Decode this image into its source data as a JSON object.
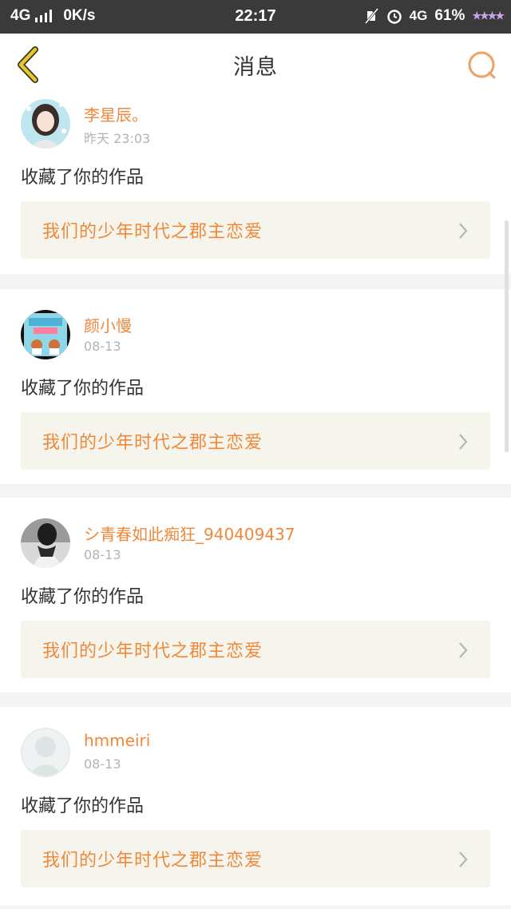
{
  "status_bar": {
    "network": "4G",
    "speed": "0K/s",
    "time": "22:17",
    "network_right": "4G",
    "battery": "61%"
  },
  "nav": {
    "title": "消息"
  },
  "messages": [
    {
      "user": "李星辰。",
      "time": "昨天 23:03",
      "action": "收藏了你的作品",
      "work_title": "我们的少年时代之郡主恋爱"
    },
    {
      "user": "颜小慢",
      "time": "08-13",
      "action": "收藏了你的作品",
      "work_title": "我们的少年时代之郡主恋爱"
    },
    {
      "user": "シ青春如此痴狂_940409437",
      "time": "08-13",
      "action": "收藏了你的作品",
      "work_title": "我们的少年时代之郡主恋爱"
    },
    {
      "user": "hmmeiri",
      "time": "08-13",
      "action": "收藏了你的作品",
      "work_title": "我们的少年时代之郡主恋爱"
    }
  ],
  "colors": {
    "accent": "#f0883a",
    "back_arrow": "#e8c832",
    "status_bar_bg": "#3a3a3a"
  }
}
